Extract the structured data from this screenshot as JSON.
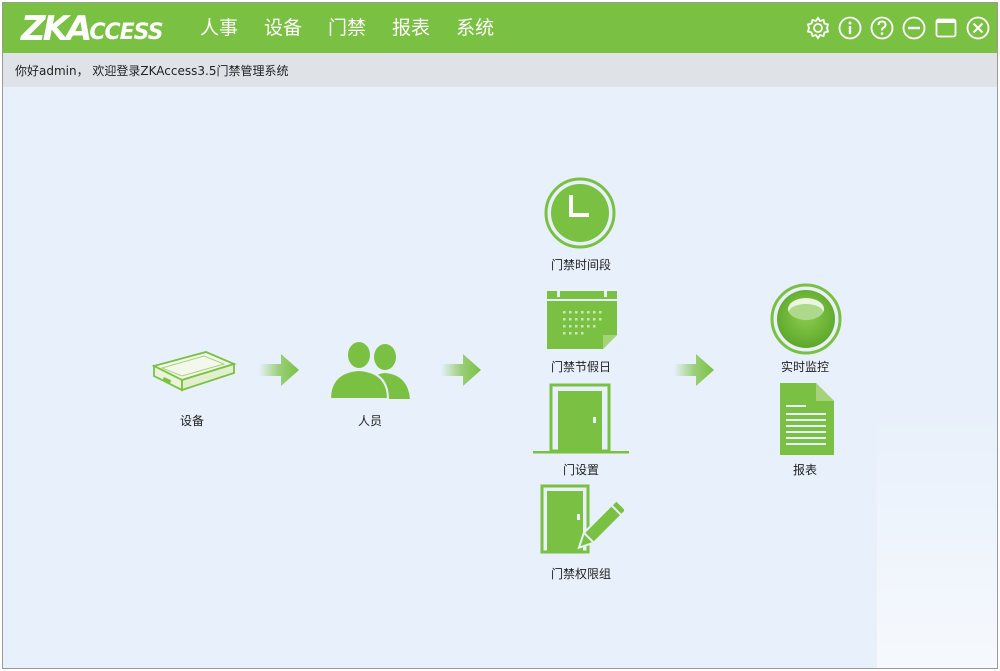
{
  "app": {
    "logo_main": "ZKA",
    "logo_sub": "CCESS"
  },
  "menu": {
    "items": [
      {
        "label": "人事"
      },
      {
        "label": "设备"
      },
      {
        "label": "门禁"
      },
      {
        "label": "报表"
      },
      {
        "label": "系统"
      }
    ]
  },
  "greeting": "你好admin，  欢迎登录ZKAccess3.5门禁管理系统",
  "flow": {
    "device": "设备",
    "personnel": "人员",
    "time_zone": "门禁时间段",
    "holiday": "门禁节假日",
    "door_setup": "门设置",
    "access_level": "门禁权限组",
    "realtime_monitor": "实时监控",
    "report": "报表"
  },
  "colors": {
    "brand_green": "#7ac143",
    "background": "#e8f0fb"
  }
}
